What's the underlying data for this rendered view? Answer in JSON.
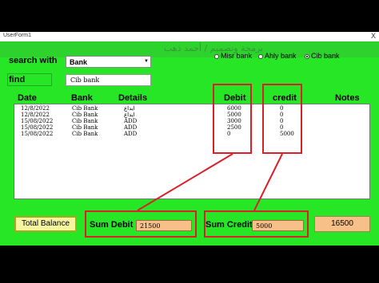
{
  "window": {
    "title": "UserForm1",
    "close_glyph": "X",
    "banner_text": "برمجة وتصميم / أحمد ذهب"
  },
  "search": {
    "label": "search with",
    "selected": "Bank",
    "dropdown_icon": "dropdown-arrow"
  },
  "find": {
    "label": "find",
    "value": "Cib bank"
  },
  "banks": [
    {
      "label": "Misr bank",
      "selected": false
    },
    {
      "label": "Ahly bank",
      "selected": false
    },
    {
      "label": "Cib bank",
      "selected": true
    }
  ],
  "columns": {
    "date": "Date",
    "bank": "Bank",
    "details": "Details",
    "debit": "Debit",
    "credit": "credit",
    "notes": "Notes"
  },
  "rows": [
    {
      "date": "12/8/2022",
      "bank": "Cib Bank",
      "details": "ايداع",
      "debit": "6000",
      "credit": "0"
    },
    {
      "date": "12/8/2022",
      "bank": "Cib Bank",
      "details": "ايداع",
      "debit": "5000",
      "credit": "0"
    },
    {
      "date": "15/08/2022",
      "bank": "Cib Bank",
      "details": "ADD",
      "debit": "3000",
      "credit": "0"
    },
    {
      "date": "15/08/2022",
      "bank": "Cib Bank",
      "details": "ADD",
      "debit": "2500",
      "credit": "0"
    },
    {
      "date": "15/08/2022",
      "bank": "Cib Bank",
      "details": "ADD",
      "debit": "0",
      "credit": "5000"
    }
  ],
  "footer": {
    "total_balance_label": "Total Balance",
    "sum_debit_label": "Sum Debit",
    "sum_debit_value": "21500",
    "sum_credit_label": "Sum Credit",
    "sum_credit_value": "5000",
    "balance_value": "16500"
  },
  "colors": {
    "form_bg": "#26e626",
    "highlight": "#d9202a",
    "value_box": "#f7c089",
    "total_btn": "#f6f6a0"
  }
}
